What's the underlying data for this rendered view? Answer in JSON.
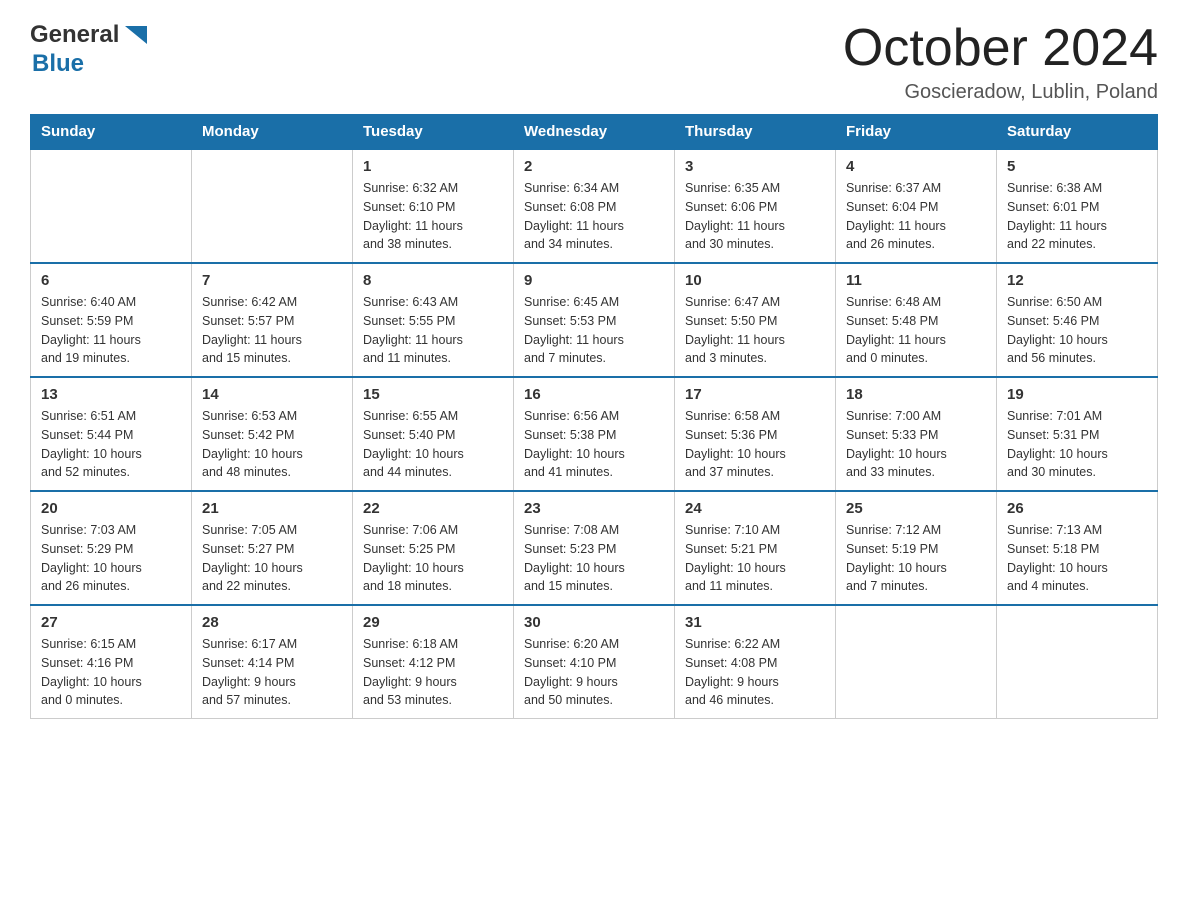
{
  "header": {
    "logo_general": "General",
    "logo_blue": "Blue",
    "title": "October 2024",
    "subtitle": "Goscieradow, Lublin, Poland"
  },
  "calendar": {
    "days_of_week": [
      "Sunday",
      "Monday",
      "Tuesday",
      "Wednesday",
      "Thursday",
      "Friday",
      "Saturday"
    ],
    "weeks": [
      [
        {
          "day": "",
          "info": ""
        },
        {
          "day": "",
          "info": ""
        },
        {
          "day": "1",
          "info": "Sunrise: 6:32 AM\nSunset: 6:10 PM\nDaylight: 11 hours\nand 38 minutes."
        },
        {
          "day": "2",
          "info": "Sunrise: 6:34 AM\nSunset: 6:08 PM\nDaylight: 11 hours\nand 34 minutes."
        },
        {
          "day": "3",
          "info": "Sunrise: 6:35 AM\nSunset: 6:06 PM\nDaylight: 11 hours\nand 30 minutes."
        },
        {
          "day": "4",
          "info": "Sunrise: 6:37 AM\nSunset: 6:04 PM\nDaylight: 11 hours\nand 26 minutes."
        },
        {
          "day": "5",
          "info": "Sunrise: 6:38 AM\nSunset: 6:01 PM\nDaylight: 11 hours\nand 22 minutes."
        }
      ],
      [
        {
          "day": "6",
          "info": "Sunrise: 6:40 AM\nSunset: 5:59 PM\nDaylight: 11 hours\nand 19 minutes."
        },
        {
          "day": "7",
          "info": "Sunrise: 6:42 AM\nSunset: 5:57 PM\nDaylight: 11 hours\nand 15 minutes."
        },
        {
          "day": "8",
          "info": "Sunrise: 6:43 AM\nSunset: 5:55 PM\nDaylight: 11 hours\nand 11 minutes."
        },
        {
          "day": "9",
          "info": "Sunrise: 6:45 AM\nSunset: 5:53 PM\nDaylight: 11 hours\nand 7 minutes."
        },
        {
          "day": "10",
          "info": "Sunrise: 6:47 AM\nSunset: 5:50 PM\nDaylight: 11 hours\nand 3 minutes."
        },
        {
          "day": "11",
          "info": "Sunrise: 6:48 AM\nSunset: 5:48 PM\nDaylight: 11 hours\nand 0 minutes."
        },
        {
          "day": "12",
          "info": "Sunrise: 6:50 AM\nSunset: 5:46 PM\nDaylight: 10 hours\nand 56 minutes."
        }
      ],
      [
        {
          "day": "13",
          "info": "Sunrise: 6:51 AM\nSunset: 5:44 PM\nDaylight: 10 hours\nand 52 minutes."
        },
        {
          "day": "14",
          "info": "Sunrise: 6:53 AM\nSunset: 5:42 PM\nDaylight: 10 hours\nand 48 minutes."
        },
        {
          "day": "15",
          "info": "Sunrise: 6:55 AM\nSunset: 5:40 PM\nDaylight: 10 hours\nand 44 minutes."
        },
        {
          "day": "16",
          "info": "Sunrise: 6:56 AM\nSunset: 5:38 PM\nDaylight: 10 hours\nand 41 minutes."
        },
        {
          "day": "17",
          "info": "Sunrise: 6:58 AM\nSunset: 5:36 PM\nDaylight: 10 hours\nand 37 minutes."
        },
        {
          "day": "18",
          "info": "Sunrise: 7:00 AM\nSunset: 5:33 PM\nDaylight: 10 hours\nand 33 minutes."
        },
        {
          "day": "19",
          "info": "Sunrise: 7:01 AM\nSunset: 5:31 PM\nDaylight: 10 hours\nand 30 minutes."
        }
      ],
      [
        {
          "day": "20",
          "info": "Sunrise: 7:03 AM\nSunset: 5:29 PM\nDaylight: 10 hours\nand 26 minutes."
        },
        {
          "day": "21",
          "info": "Sunrise: 7:05 AM\nSunset: 5:27 PM\nDaylight: 10 hours\nand 22 minutes."
        },
        {
          "day": "22",
          "info": "Sunrise: 7:06 AM\nSunset: 5:25 PM\nDaylight: 10 hours\nand 18 minutes."
        },
        {
          "day": "23",
          "info": "Sunrise: 7:08 AM\nSunset: 5:23 PM\nDaylight: 10 hours\nand 15 minutes."
        },
        {
          "day": "24",
          "info": "Sunrise: 7:10 AM\nSunset: 5:21 PM\nDaylight: 10 hours\nand 11 minutes."
        },
        {
          "day": "25",
          "info": "Sunrise: 7:12 AM\nSunset: 5:19 PM\nDaylight: 10 hours\nand 7 minutes."
        },
        {
          "day": "26",
          "info": "Sunrise: 7:13 AM\nSunset: 5:18 PM\nDaylight: 10 hours\nand 4 minutes."
        }
      ],
      [
        {
          "day": "27",
          "info": "Sunrise: 6:15 AM\nSunset: 4:16 PM\nDaylight: 10 hours\nand 0 minutes."
        },
        {
          "day": "28",
          "info": "Sunrise: 6:17 AM\nSunset: 4:14 PM\nDaylight: 9 hours\nand 57 minutes."
        },
        {
          "day": "29",
          "info": "Sunrise: 6:18 AM\nSunset: 4:12 PM\nDaylight: 9 hours\nand 53 minutes."
        },
        {
          "day": "30",
          "info": "Sunrise: 6:20 AM\nSunset: 4:10 PM\nDaylight: 9 hours\nand 50 minutes."
        },
        {
          "day": "31",
          "info": "Sunrise: 6:22 AM\nSunset: 4:08 PM\nDaylight: 9 hours\nand 46 minutes."
        },
        {
          "day": "",
          "info": ""
        },
        {
          "day": "",
          "info": ""
        }
      ]
    ]
  }
}
